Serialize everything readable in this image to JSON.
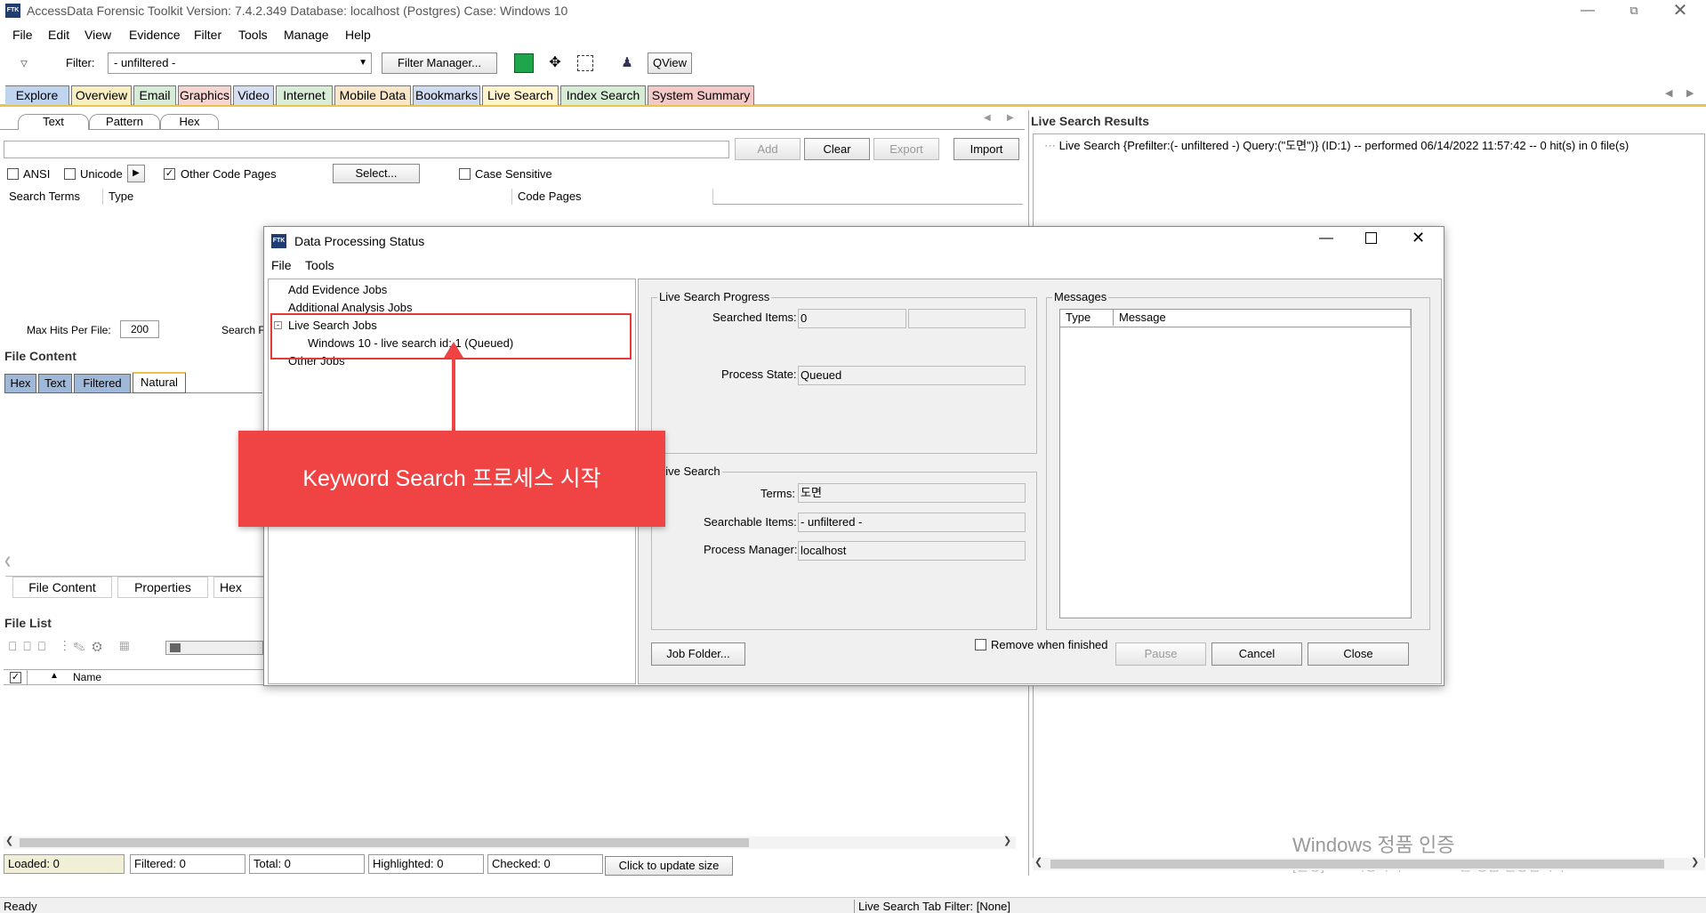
{
  "window": {
    "title": "AccessData Forensic Toolkit Version: 7.4.2.349 Database: localhost (Postgres) Case: Windows 10",
    "icon_text": "FTK"
  },
  "menu": [
    "File",
    "Edit",
    "View",
    "Evidence",
    "Filter",
    "Tools",
    "Manage",
    "Help"
  ],
  "toolbar": {
    "filter_label": "Filter:",
    "filter_value": "- unfiltered -",
    "filter_manager": "Filter Manager...",
    "qview": "QView"
  },
  "tabs": [
    "Explore",
    "Overview",
    "Email",
    "Graphics",
    "Video",
    "Internet",
    "Mobile Data",
    "Bookmarks",
    "Live Search",
    "Index Search",
    "System Summary"
  ],
  "search_tabs": [
    "Text",
    "Pattern",
    "Hex"
  ],
  "search_buttons": {
    "add": "Add",
    "clear": "Clear",
    "export": "Export",
    "import": "Import"
  },
  "search_options": {
    "ansi": "ANSI",
    "unicode": "Unicode",
    "other_code_pages": "Other Code Pages",
    "select": "Select...",
    "case_sensitive": "Case Sensitive"
  },
  "search_table_headers": [
    "Search Terms",
    "Type",
    "Code Pages"
  ],
  "max_hits": {
    "label": "Max Hits Per File:",
    "value": "200",
    "search_label": "Search F"
  },
  "file_content": {
    "title": "File Content",
    "tabs": [
      "Hex",
      "Text",
      "Filtered",
      "Natural"
    ]
  },
  "bottom_tabs": [
    "File Content",
    "Properties",
    "Hex Inte"
  ],
  "file_list": {
    "title": "File List",
    "name_header": "Name"
  },
  "status_cells": [
    "Loaded: 0",
    "Filtered: 0",
    "Total: 0",
    "Highlighted: 0",
    "Checked: 0"
  ],
  "update_size_button": "Click to update size",
  "live_results": {
    "title": "Live Search Results",
    "entry": "Live Search {Prefilter:(- unfiltered -) Query:(\"도면\")} (ID:1) -- performed 06/14/2022 11:57:42 -- 0 hit(s) in 0 file(s)"
  },
  "watermark": {
    "line1": "Windows 정품 인증",
    "line2": "[설정]으로 이동하여 Windows를 정품 인증합니다."
  },
  "statusbar": {
    "left": "Ready",
    "right": "Live Search Tab Filter: [None]"
  },
  "dialog": {
    "title": "Data Processing Status",
    "menu": [
      "File",
      "Tools"
    ],
    "tree": {
      "add_evidence": "Add Evidence Jobs",
      "additional": "Additional Analysis Jobs",
      "live_search": "Live Search Jobs",
      "job_item": "Windows 10 - live search id: 1 (Queued)",
      "other": "Other Jobs"
    },
    "progress_group": "Live Search Progress",
    "searched_items_label": "Searched Items:",
    "searched_items_value": "0",
    "process_state_label": "Process State:",
    "process_state_value": "Queued",
    "search_group": "Live Search",
    "terms_label": "Terms:",
    "terms_value": "도면",
    "searchable_label": "Searchable Items:",
    "searchable_value": "- unfiltered -",
    "manager_label": "Process Manager:",
    "manager_value": "localhost",
    "messages_group": "Messages",
    "messages_headers": [
      "Type",
      "Message"
    ],
    "job_folder": "Job Folder...",
    "remove_when_finished": "Remove when finished",
    "pause": "Pause",
    "cancel": "Cancel",
    "close": "Close"
  },
  "callout": {
    "text": "Keyword Search 프로세스 시작"
  },
  "colors": {
    "accent_tab_border": "#e8c54a",
    "callout_red": "#f04444",
    "highlight_box": "#e53935"
  }
}
